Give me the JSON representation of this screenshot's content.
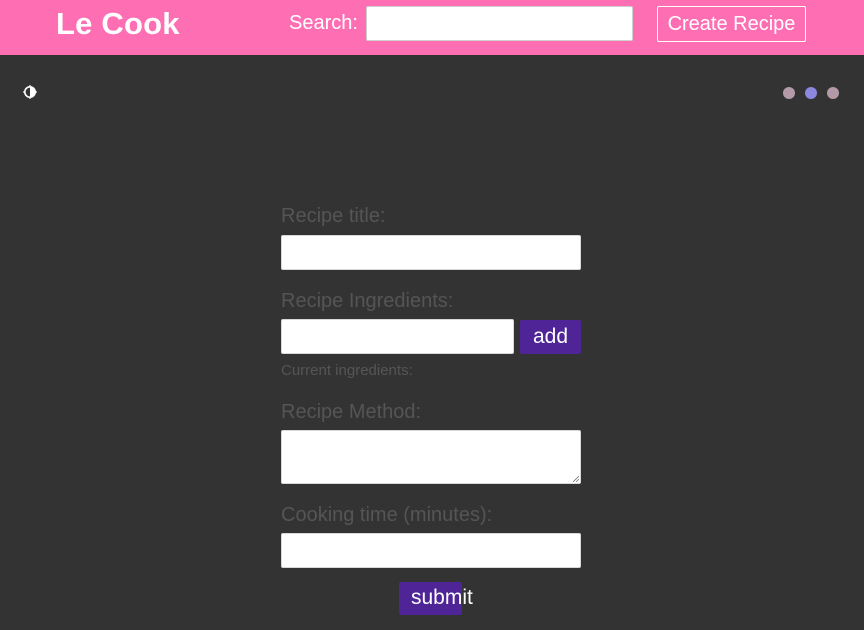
{
  "header": {
    "brand": "Le Cook",
    "search_label": "Search:",
    "search_value": "",
    "create_recipe_label": "Create Recipe"
  },
  "toolbar": {
    "theme_toggle_icon": "contrast-icon",
    "window_dots": [
      {
        "name": "dot-1",
        "color": "#b49aa8"
      },
      {
        "name": "dot-2",
        "color": "#8c87e0"
      },
      {
        "name": "dot-3",
        "color": "#b49aa8"
      }
    ]
  },
  "form": {
    "title_label": "Recipe title:",
    "title_value": "",
    "ingredients_label": "Recipe Ingredients:",
    "ingredient_value": "",
    "add_label": "add",
    "current_ingredients_label": "Current ingredients:",
    "method_label": "Recipe Method:",
    "method_value": "",
    "cooking_time_label": "Cooking time (minutes):",
    "cooking_time_value": "",
    "submit_label": "submit"
  },
  "colors": {
    "navbar": "#fe6eb3",
    "background": "#333333",
    "button": "#4e2496",
    "label": "#555555"
  }
}
